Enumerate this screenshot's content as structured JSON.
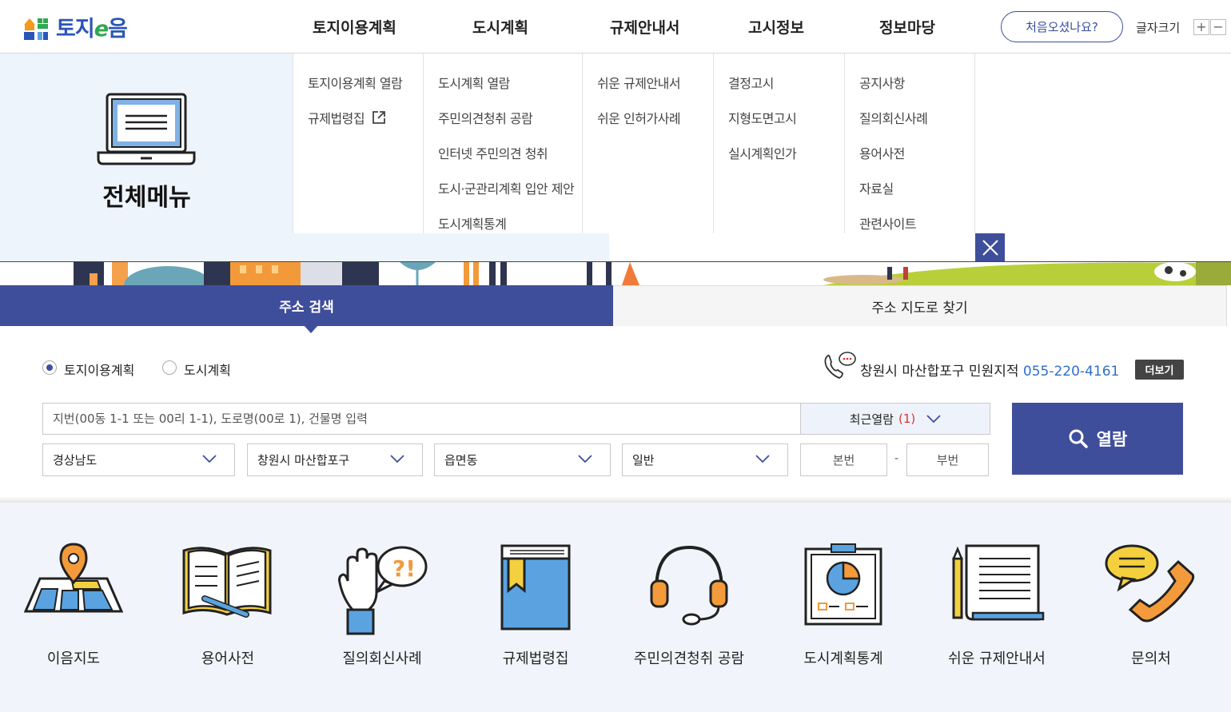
{
  "header": {
    "logo_text": "토지e음",
    "gnb": [
      "토지이용계획",
      "도시계획",
      "규제안내서",
      "고시정보",
      "정보마당"
    ],
    "first_visit_label": "처음오셨나요?",
    "font_size_label": "글자크기",
    "font_plus": "+",
    "font_minus": "−"
  },
  "mega_menu": {
    "title": "전체메뉴",
    "columns": [
      [
        "토지이용계획 열람",
        "규제법령집"
      ],
      [
        "도시계획 열람",
        "주민의견청취 공람",
        "인터넷 주민의견 청취",
        "도시·군관리계획 입안 제안",
        "도시계획통계"
      ],
      [
        "쉬운 규제안내서",
        "쉬운 인허가사례"
      ],
      [
        "결정고시",
        "지형도면고시",
        "실시계획인가"
      ],
      [
        "공지사항",
        "질의회신사례",
        "용어사전",
        "자료실",
        "관련사이트"
      ]
    ]
  },
  "tabs": {
    "address_search": "주소 검색",
    "map_search": "주소 지도로 찾기"
  },
  "search": {
    "radio_land": "토지이용계획",
    "radio_city": "도시계획",
    "contact_prefix": "창원시 마산합포구 민원지적 ",
    "contact_phone": "055-220-4161",
    "more_label": "더보기",
    "address_placeholder": "지번(00동 1-1 또는 00리 1-1), 도로명(00로 1), 건물명 입력",
    "recent_label": "최근열람",
    "recent_count": "(1)",
    "select_province": "경상남도",
    "select_city": "창원시 마산합포구",
    "select_town": "읍면동",
    "select_type": "일반",
    "main_no": "본번",
    "sub_no": "부번",
    "dash": "-",
    "view_button": "열람"
  },
  "quick_menu": [
    {
      "label": "이음지도",
      "icon": "map-pin-icon"
    },
    {
      "label": "용어사전",
      "icon": "dictionary-icon"
    },
    {
      "label": "질의회신사례",
      "icon": "question-hand-icon"
    },
    {
      "label": "규제법령집",
      "icon": "law-book-icon"
    },
    {
      "label": "주민의견청취 공람",
      "icon": "headset-icon"
    },
    {
      "label": "도시계획통계",
      "icon": "chart-board-icon"
    },
    {
      "label": "쉬운 규제안내서",
      "icon": "document-pencil-icon"
    },
    {
      "label": "문의처",
      "icon": "phone-chat-icon"
    }
  ],
  "colors": {
    "primary": "#3f4e9b",
    "phone_link": "#2f6fc7",
    "recent_count": "#dd3333",
    "menu_bg": "#eef4fb",
    "quick_bg": "#f1f5fb"
  }
}
